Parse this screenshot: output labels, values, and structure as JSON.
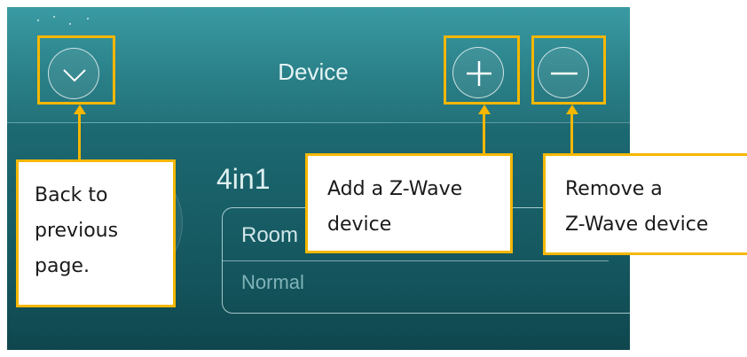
{
  "header": {
    "title": "Device",
    "back_icon": "chevron-down-icon",
    "add_icon": "plus-icon",
    "remove_icon": "minus-icon"
  },
  "device": {
    "name": "4in1",
    "room": "Room",
    "status": "Normal"
  },
  "callouts": {
    "back": [
      "Back to",
      "previous",
      "page."
    ],
    "add": [
      "Add a Z-Wave",
      "device"
    ],
    "remove": [
      "Remove a",
      "Z-Wave device"
    ]
  },
  "colors": {
    "highlight": "#f5b700",
    "screen_teal": "#1c6a73"
  }
}
